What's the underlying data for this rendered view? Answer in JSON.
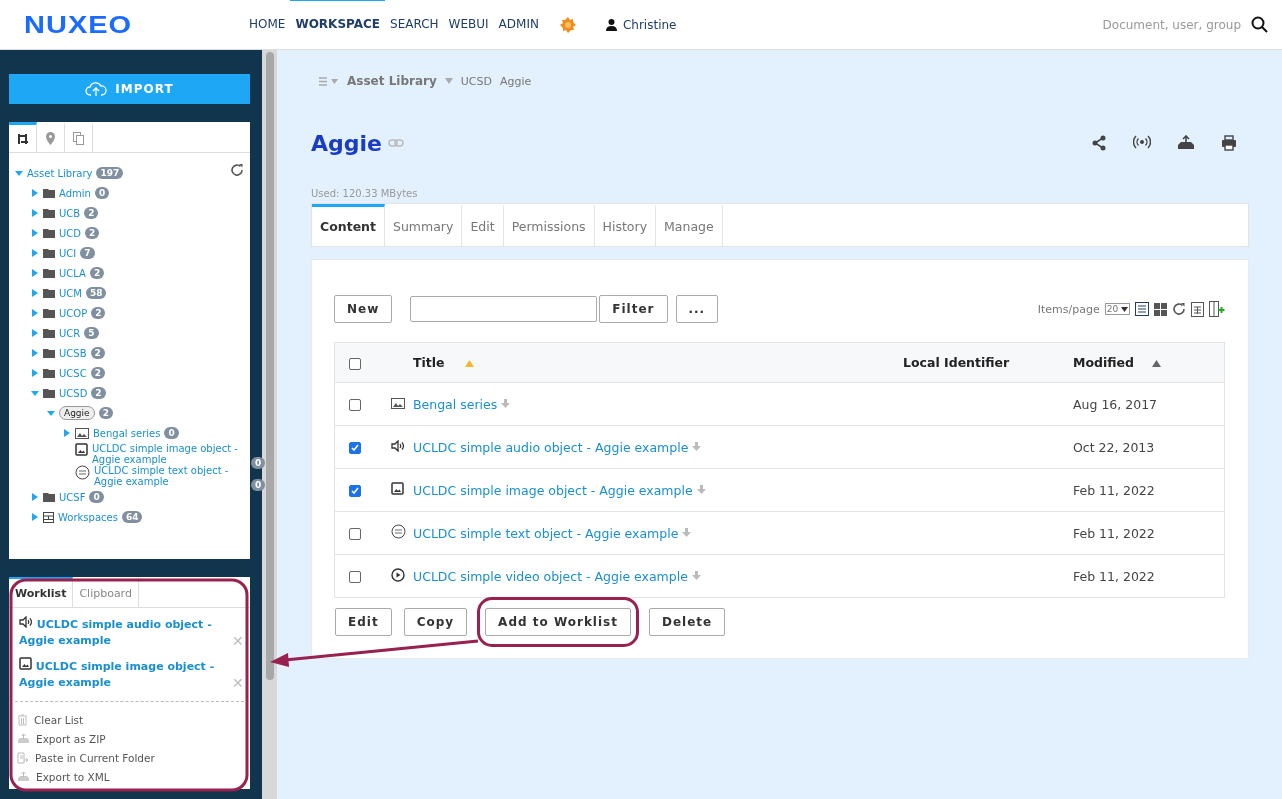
{
  "header": {
    "logo": "NUXEO",
    "nav": [
      {
        "label": "HOME",
        "selected": false
      },
      {
        "label": "WORKSPACE",
        "selected": true
      },
      {
        "label": "SEARCH",
        "selected": false
      },
      {
        "label": "WEBUI",
        "selected": false
      },
      {
        "label": "ADMIN",
        "selected": false
      }
    ],
    "user": "Christine",
    "search": {
      "placeholder": "Document, user, group"
    }
  },
  "sidebar": {
    "import_button": "IMPORT",
    "tree_tabs": [
      {
        "kind": "tree",
        "selected": true
      },
      {
        "kind": "pin",
        "selected": false
      },
      {
        "kind": "copy",
        "selected": false
      }
    ],
    "tree": [
      {
        "label": "Asset Library",
        "count": "197",
        "expanded": true,
        "selected": false,
        "children": [
          {
            "label": "Admin",
            "count": "0",
            "kind": "folder",
            "expanded": false,
            "selected": false
          },
          {
            "label": "UCB",
            "count": "2",
            "kind": "folder",
            "expanded": false,
            "selected": false
          },
          {
            "label": "UCD",
            "count": "2",
            "kind": "folder",
            "expanded": false,
            "selected": false
          },
          {
            "label": "UCI",
            "count": "7",
            "kind": "folder",
            "expanded": false,
            "selected": false
          },
          {
            "label": "UCLA",
            "count": "2",
            "kind": "folder",
            "expanded": false,
            "selected": false
          },
          {
            "label": "UCM",
            "count": "58",
            "kind": "folder",
            "expanded": false,
            "selected": false
          },
          {
            "label": "UCOP",
            "count": "2",
            "kind": "folder",
            "expanded": false,
            "selected": false
          },
          {
            "label": "UCR",
            "count": "5",
            "kind": "folder",
            "expanded": false,
            "selected": false
          },
          {
            "label": "UCSB",
            "count": "2",
            "kind": "folder",
            "expanded": false,
            "selected": false
          },
          {
            "label": "UCSC",
            "count": "2",
            "kind": "folder",
            "expanded": false,
            "selected": false
          },
          {
            "label": "UCSD",
            "count": "2",
            "kind": "folder",
            "expanded": true,
            "selected": false,
            "children": [
              {
                "label": "Aggie",
                "count": "2",
                "expanded": true,
                "selected": true,
                "children": [
                  {
                    "label": "Bengal series",
                    "count": "0",
                    "kind": "picture",
                    "expanded": false,
                    "selected": false
                  },
                  {
                    "label": "UCLDC simple image object - Aggie example",
                    "count": "0",
                    "kind": "image",
                    "selected": false
                  },
                  {
                    "label": "UCLDC simple text object - Aggie example",
                    "count": "0",
                    "kind": "pdf",
                    "selected": false
                  }
                ]
              }
            ]
          },
          {
            "label": "UCSF",
            "count": "0",
            "kind": "folder",
            "expanded": false,
            "selected": false
          },
          {
            "label": "Workspaces",
            "count": "64",
            "kind": "workspaces",
            "expanded": false,
            "selected": false
          }
        ]
      }
    ],
    "worklist": {
      "tabs": [
        {
          "label": "Worklist",
          "selected": true
        },
        {
          "label": "Clipboard",
          "selected": false
        }
      ],
      "items": [
        {
          "kind": "audio",
          "title": "UCLDC simple audio object - Aggie example",
          "remove": "✕"
        },
        {
          "kind": "image",
          "title": "UCLDC simple image object - Aggie example",
          "remove": "✕"
        }
      ],
      "actions": [
        {
          "kind": "trash",
          "label": "Clear List"
        },
        {
          "kind": "export",
          "label": "Export as ZIP"
        },
        {
          "kind": "paste",
          "label": "Paste in Current Folder"
        },
        {
          "kind": "export",
          "label": "Export to XML"
        }
      ]
    }
  },
  "main": {
    "breadcrumb": [
      "Asset Library",
      "UCSD",
      "Aggie"
    ],
    "title": "Aggie",
    "used": "Used: 120.33 MBytes",
    "tabs": [
      {
        "label": "Content",
        "selected": true
      },
      {
        "label": "Summary",
        "selected": false
      },
      {
        "label": "Edit",
        "selected": false
      },
      {
        "label": "Permissions",
        "selected": false
      },
      {
        "label": "History",
        "selected": false
      },
      {
        "label": "Manage",
        "selected": false
      }
    ],
    "toolbar": {
      "new_button": "New",
      "filter_button": "Filter",
      "more_button": "...",
      "items_per_page_label": "Items/page",
      "items_per_page": "20"
    },
    "table": {
      "columns": [
        "Title",
        "Local Identifier",
        "Modified"
      ],
      "select_all_checked": false,
      "rows": [
        {
          "kind": "picture",
          "title": "Bengal series",
          "modified": "Aug 16, 2017",
          "checked": false
        },
        {
          "kind": "audio",
          "title": "UCLDC simple audio object - Aggie example",
          "modified": "Oct 22, 2013",
          "checked": true
        },
        {
          "kind": "image",
          "title": "UCLDC simple image object - Aggie example",
          "modified": "Feb 11, 2022",
          "checked": true
        },
        {
          "kind": "pdf",
          "title": "UCLDC simple text object - Aggie example",
          "modified": "Feb 11, 2022",
          "checked": false
        },
        {
          "kind": "video",
          "title": "UCLDC simple video object - Aggie example",
          "modified": "Feb 11, 2022",
          "checked": false
        }
      ]
    },
    "actions": [
      {
        "label": "Edit",
        "highlighted": false
      },
      {
        "label": "Copy",
        "highlighted": false
      },
      {
        "label": "Add to Worklist",
        "highlighted": true
      },
      {
        "label": "Delete",
        "highlighted": false
      }
    ]
  }
}
